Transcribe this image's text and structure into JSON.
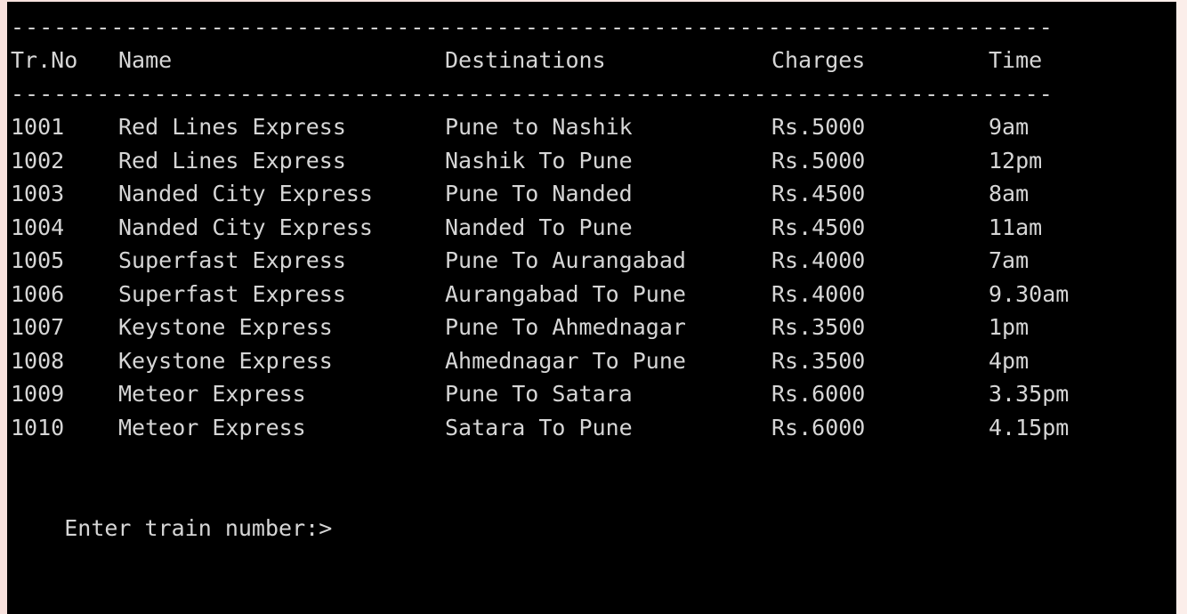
{
  "console": {
    "separator": "--------------------------------------------------------------------------------",
    "headers": {
      "no": "Tr.No",
      "name": "Name",
      "dest": "Destinations",
      "charges": "Charges",
      "time": "Time"
    },
    "rows": [
      {
        "no": "1001",
        "name": "Red Lines Express",
        "dest": "Pune to Nashik",
        "charges": "Rs.5000",
        "time": "9am"
      },
      {
        "no": "1002",
        "name": "Red Lines Express",
        "dest": "Nashik To Pune",
        "charges": "Rs.5000",
        "time": "12pm"
      },
      {
        "no": "1003",
        "name": "Nanded City Express",
        "dest": "Pune To Nanded",
        "charges": "Rs.4500",
        "time": "8am"
      },
      {
        "no": "1004",
        "name": "Nanded City Express",
        "dest": "Nanded To Pune",
        "charges": "Rs.4500",
        "time": "11am"
      },
      {
        "no": "1005",
        "name": "Superfast Express",
        "dest": "Pune To Aurangabad",
        "charges": "Rs.4000",
        "time": "7am"
      },
      {
        "no": "1006",
        "name": "Superfast Express",
        "dest": "Aurangabad To Pune",
        "charges": "Rs.4000",
        "time": "9.30am"
      },
      {
        "no": "1007",
        "name": "Keystone Express",
        "dest": "Pune To Ahmednagar",
        "charges": "Rs.3500",
        "time": "1pm"
      },
      {
        "no": "1008",
        "name": "Keystone Express",
        "dest": "Ahmednagar To Pune",
        "charges": "Rs.3500",
        "time": "4pm"
      },
      {
        "no": "1009",
        "name": "Meteor Express",
        "dest": "Pune To Satara",
        "charges": "Rs.6000",
        "time": "3.35pm"
      },
      {
        "no": "1010",
        "name": "Meteor Express",
        "dest": "Satara To Pune",
        "charges": "Rs.6000",
        "time": "4.15pm"
      }
    ],
    "prompt": "Enter train number:>"
  },
  "colors": {
    "background": "#000000",
    "text": "#d6d6d6",
    "page": "#f7e1dd"
  }
}
